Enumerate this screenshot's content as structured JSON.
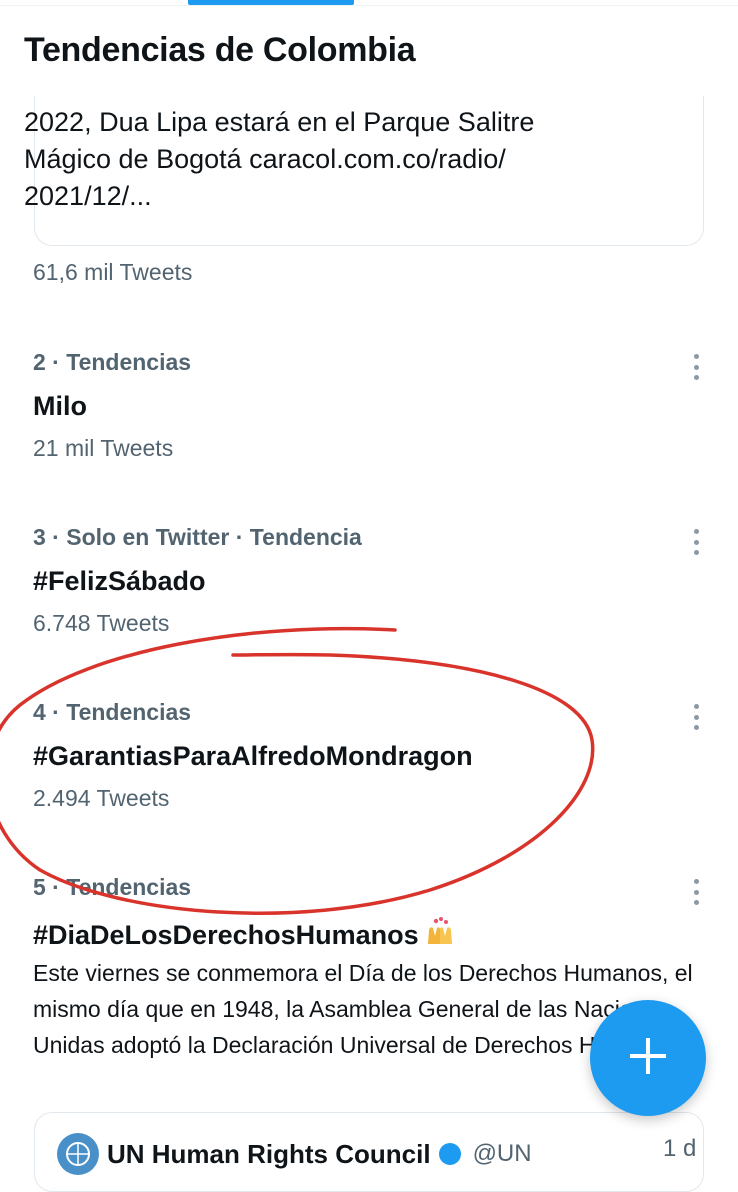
{
  "header": {
    "title": "Tendencias de Colombia"
  },
  "trend_card": {
    "lines": [
      "2022, Dua Lipa estará en el Parque Salitre",
      "Mágico de Bogotá caracol.com.co/radio/",
      "2021/12/..."
    ],
    "tweet_count": "61,6 mil Tweets"
  },
  "trends": [
    {
      "meta": "2 · Tendencias",
      "name": "Milo",
      "count": "21 mil Tweets"
    },
    {
      "meta": "3 · Solo en Twitter · Tendencia",
      "name": "#FelizSábado",
      "count": "6.748 Tweets"
    },
    {
      "meta": "4 · Tendencias",
      "name": "#GarantiasParaAlfredoMondragon",
      "count": "2.494 Tweets"
    },
    {
      "meta": "5 · Tendencias",
      "name": "#DiaDeLosDerechosHumanos",
      "emoji": "🙌",
      "description": "Este viernes se conmemora el Día de los Derechos Humanos, el mismo día que en 1948, la Asamblea General de las Naciones Unidas adoptó la Declaración Universal de Derechos Humanos"
    }
  ],
  "quoted_tweet": {
    "name": "UN Human Rights Council",
    "handle": "@UN",
    "time": "1 d"
  },
  "annotation": {
    "color": "#d9342b"
  },
  "icons": {
    "more": "more-vertical-icon",
    "compose": "plus-icon"
  }
}
